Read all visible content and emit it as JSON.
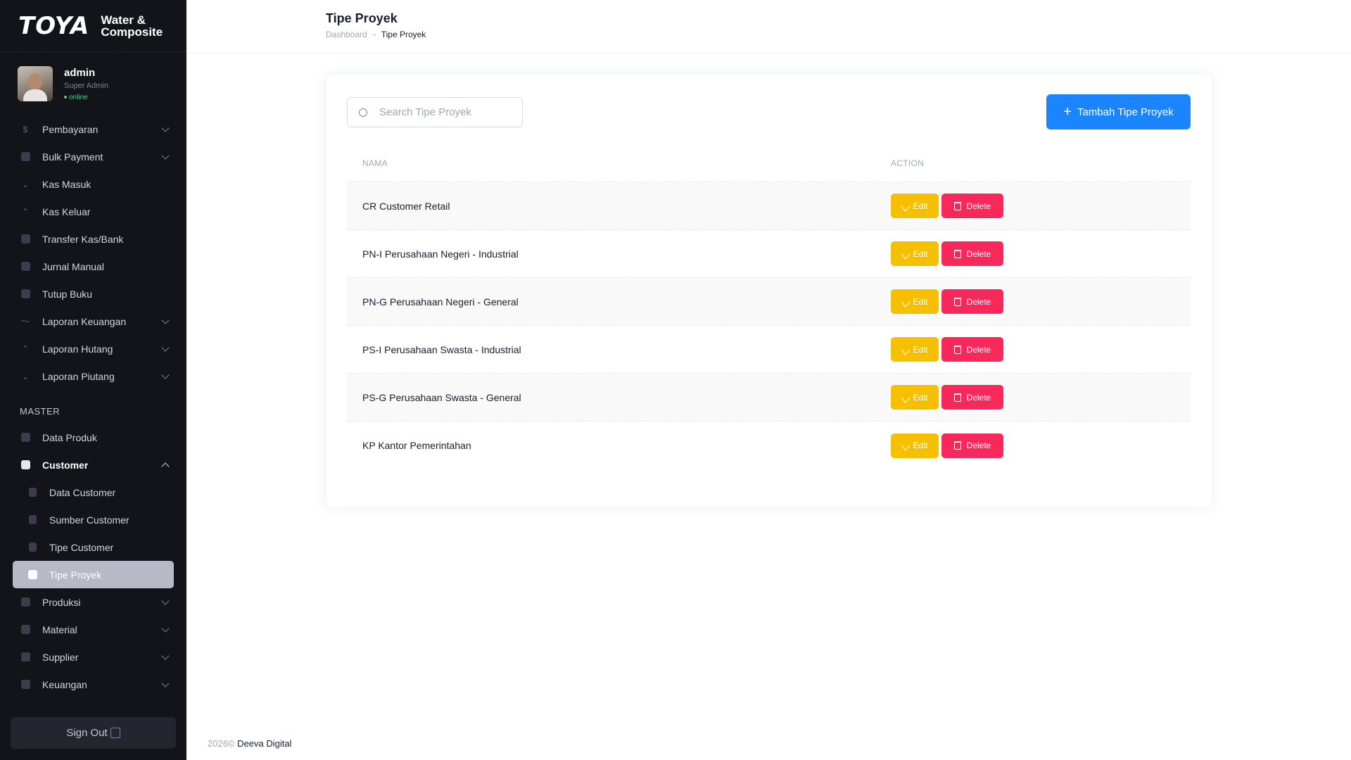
{
  "brand": {
    "logo": "TOYA",
    "sub_line1": "Water &",
    "sub_line2": "Composite"
  },
  "user": {
    "name": "admin",
    "role": "Super Admin",
    "status": "online"
  },
  "sidebar": {
    "top_items": [
      {
        "label": "Pembayaran",
        "icon": "dollar-icon",
        "expandable": true
      },
      {
        "label": "Bulk Payment",
        "icon": "wallet-icon",
        "expandable": true
      },
      {
        "label": "Kas Masuk",
        "icon": "arrow-down-icon",
        "expandable": false
      },
      {
        "label": "Kas Keluar",
        "icon": "arrow-up-icon",
        "expandable": false
      },
      {
        "label": "Transfer Kas/Bank",
        "icon": "transfer-icon",
        "expandable": false
      },
      {
        "label": "Jurnal Manual",
        "icon": "document-icon",
        "expandable": false
      },
      {
        "label": "Tutup Buku",
        "icon": "calendar-icon",
        "expandable": false
      },
      {
        "label": "Laporan Keuangan",
        "icon": "chart-icon",
        "expandable": true
      },
      {
        "label": "Laporan Hutang",
        "icon": "arrow-up-icon",
        "expandable": true
      },
      {
        "label": "Laporan Piutang",
        "icon": "arrow-down-icon",
        "expandable": true
      }
    ],
    "section_master": "MASTER",
    "master_items": {
      "data_produk": "Data Produk",
      "customer": "Customer",
      "sub": [
        "Data Customer",
        "Sumber Customer",
        "Tipe Customer",
        "Tipe Proyek"
      ],
      "after": [
        "Produksi",
        "Material",
        "Supplier",
        "Keuangan"
      ]
    },
    "signout": "Sign Out"
  },
  "header": {
    "title": "Tipe Proyek",
    "breadcrumb": [
      "Dashboard",
      "Tipe Proyek"
    ]
  },
  "search": {
    "placeholder": "Search Tipe Proyek",
    "value": ""
  },
  "add_button": {
    "label": "Tambah Tipe Proyek"
  },
  "table": {
    "columns": [
      "NAMA",
      "ACTION"
    ],
    "rows": [
      "CR Customer Retail",
      "PN-I Perusahaan Negeri - Industrial",
      "PN-G Perusahaan Negeri - General",
      "PS-I Perusahaan Swasta - Industrial",
      "PS-G Perusahaan Swasta - General",
      "KP Kantor Pemerintahan"
    ],
    "edit_label": "Edit",
    "delete_label": "Delete"
  },
  "footer": {
    "year": "2026©",
    "company": "Deeva Digital"
  },
  "colors": {
    "primary": "#1b84ff",
    "edit": "#f6c000",
    "delete": "#f8285a",
    "sidebar": "#131419"
  }
}
